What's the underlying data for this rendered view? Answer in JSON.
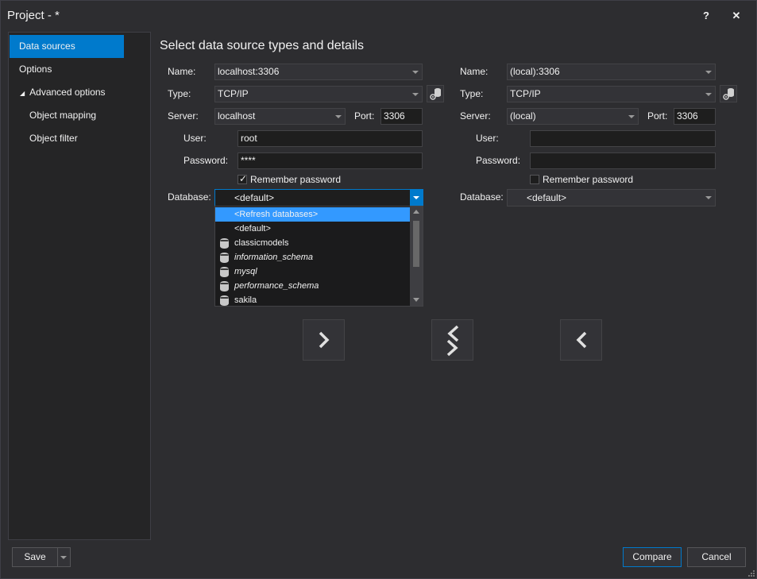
{
  "window": {
    "title": "Project - *",
    "help_label": "?",
    "close_label": "✕"
  },
  "sidebar": {
    "items": [
      {
        "label": "Data sources"
      },
      {
        "label": "Options"
      },
      {
        "label": "Advanced options",
        "expander": "◢"
      },
      {
        "label": "Object mapping"
      },
      {
        "label": "Object filter"
      }
    ]
  },
  "main": {
    "heading": "Select data source types and details",
    "labels": {
      "name": "Name:",
      "type": "Type:",
      "server": "Server:",
      "port": "Port:",
      "user": "User:",
      "password": "Password:",
      "remember": "Remember password",
      "database": "Database:"
    },
    "source": {
      "name": "localhost:3306",
      "type": "TCP/IP",
      "server": "localhost",
      "port": "3306",
      "user": "root",
      "password": "****",
      "remember_checked": true,
      "database": "<default>"
    },
    "target": {
      "name": "(local):3306",
      "type": "TCP/IP",
      "server": "(local)",
      "port": "3306",
      "user": "",
      "password": "",
      "remember_checked": false,
      "database": "<default>"
    },
    "database_dropdown": {
      "items": [
        {
          "label": "<Refresh databases>",
          "selected": true,
          "icon": null,
          "italic": false
        },
        {
          "label": "<default>",
          "selected": false,
          "icon": null,
          "italic": false
        },
        {
          "label": "classicmodels",
          "selected": false,
          "icon": "database-icon",
          "italic": false
        },
        {
          "label": "information_schema",
          "selected": false,
          "icon": "database-icon",
          "italic": true
        },
        {
          "label": "mysql",
          "selected": false,
          "icon": "database-icon",
          "italic": true
        },
        {
          "label": "performance_schema",
          "selected": false,
          "icon": "database-icon",
          "italic": true
        },
        {
          "label": "sakila",
          "selected": false,
          "icon": "database-icon",
          "italic": false
        }
      ]
    }
  },
  "footer": {
    "save_label": "Save",
    "compare_label": "Compare",
    "cancel_label": "Cancel"
  },
  "colors": {
    "accent": "#007acc",
    "selection": "#3399ff",
    "background": "#2d2d30"
  }
}
